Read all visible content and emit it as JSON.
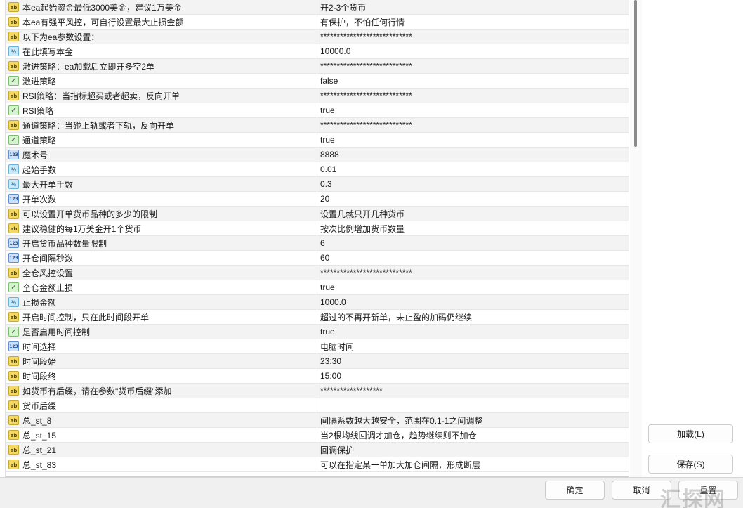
{
  "rows": [
    {
      "type": "ab",
      "name": "本ea起始资金最低3000美金，建议1万美金",
      "value": "开2-3个货币"
    },
    {
      "type": "ab",
      "name": "本ea有强平风控，可自行设置最大止损金额",
      "value": "有保护，不怕任何行情"
    },
    {
      "type": "ab",
      "name": "以下为ea参数设置：",
      "value": "****************************"
    },
    {
      "type": "half",
      "name": "在此填写本金",
      "value": "10000.0"
    },
    {
      "type": "ab",
      "name": "激进策略：ea加载后立即开多空2单",
      "value": "****************************"
    },
    {
      "type": "bool",
      "name": "激进策略",
      "value": "false"
    },
    {
      "type": "ab",
      "name": "RSI策略：当指标超买或者超卖，反向开单",
      "value": "****************************"
    },
    {
      "type": "bool",
      "name": "RSI策略",
      "value": "true"
    },
    {
      "type": "ab",
      "name": "通道策略：当碰上轨或者下轨，反向开单",
      "value": "****************************"
    },
    {
      "type": "bool",
      "name": "通道策略",
      "value": "true"
    },
    {
      "type": "int",
      "name": "魔术号",
      "value": "8888"
    },
    {
      "type": "half",
      "name": "起始手数",
      "value": "0.01"
    },
    {
      "type": "half",
      "name": "最大开单手数",
      "value": "0.3"
    },
    {
      "type": "int",
      "name": "开单次数",
      "value": "20"
    },
    {
      "type": "ab",
      "name": "可以设置开单货币品种的多少的限制",
      "value": "设置几就只开几种货币"
    },
    {
      "type": "ab",
      "name": "建议稳健的每1万美金开1个货币",
      "value": "按次比例增加货币数量"
    },
    {
      "type": "int",
      "name": "开启货币品种数量限制",
      "value": "6"
    },
    {
      "type": "int",
      "name": "开仓间隔秒数",
      "value": "60"
    },
    {
      "type": "ab",
      "name": "全仓风控设置",
      "value": "****************************"
    },
    {
      "type": "bool",
      "name": "全仓金额止损",
      "value": "true"
    },
    {
      "type": "half",
      "name": "止损金额",
      "value": "1000.0"
    },
    {
      "type": "ab",
      "name": "开启时间控制，只在此时间段开单",
      "value": "超过的不再开新单，未止盈的加码仍继续"
    },
    {
      "type": "bool",
      "name": "是否启用时间控制",
      "value": "true"
    },
    {
      "type": "int",
      "name": "时间选择",
      "value": "电脑时间"
    },
    {
      "type": "ab",
      "name": "时间段始",
      "value": "23:30"
    },
    {
      "type": "ab",
      "name": "时间段终",
      "value": "15:00"
    },
    {
      "type": "ab",
      "name": "如货币有后缀，请在参数\"货币后缀\"添加",
      "value": "*******************"
    },
    {
      "type": "ab",
      "name": "货币后缀",
      "value": ""
    },
    {
      "type": "ab",
      "name": "总_st_8",
      "value": "间隔系数越大越安全，范围在0.1-1之间调整"
    },
    {
      "type": "ab",
      "name": "总_st_15",
      "value": "当2根均线回调才加仓，趋势继续则不加仓"
    },
    {
      "type": "ab",
      "name": "总_st_21",
      "value": "回调保护"
    },
    {
      "type": "ab",
      "name": "总_st_83",
      "value": "可以在指定某一单加大加仓间隔，形成断层"
    }
  ],
  "icon_text": {
    "ab": "ab",
    "half": "½",
    "bool": "✓",
    "int": "123"
  },
  "buttons": {
    "load": "加载(L)",
    "save": "保存(S)",
    "ok": "确定",
    "cancel": "取消",
    "reset": "重置"
  },
  "watermark": "汇探网"
}
